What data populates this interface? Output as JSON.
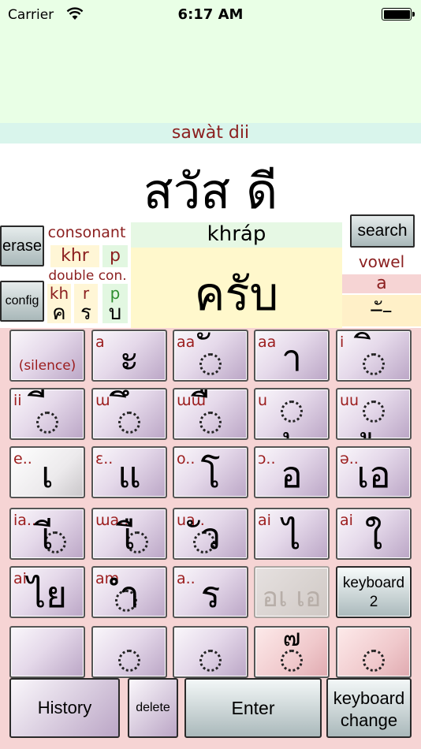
{
  "status_bar": {
    "carrier": "Carrier",
    "time": "6:17 AM"
  },
  "display": {
    "romanization": "sawàt  dii",
    "thai": "สวัส ดี"
  },
  "sidebar": {
    "erase_label": "erase",
    "config_label": "config",
    "search_label": "search"
  },
  "consonant": {
    "label": "consonant",
    "romans": [
      "khr",
      "p"
    ],
    "double_label": "double con.",
    "double": [
      {
        "roman": "kh",
        "thai": "ค"
      },
      {
        "roman": "r",
        "thai": "ร"
      },
      {
        "roman": "p",
        "thai": "บ"
      }
    ]
  },
  "current_word": {
    "roman": "khráp",
    "thai": "ครับ"
  },
  "vowel": {
    "label": "vowel",
    "roman": "a",
    "thai": "–ั–"
  },
  "keys": [
    {
      "roman": "",
      "thai": "่",
      "note": "(silence)"
    },
    {
      "roman": "a",
      "thai": "ะ"
    },
    {
      "roman": "aa",
      "thai": "ั"
    },
    {
      "roman": "aa",
      "thai": "า"
    },
    {
      "roman": "i",
      "thai": "ิ"
    },
    {
      "roman": "ii",
      "thai": "ี"
    },
    {
      "roman": "ɯ",
      "thai": "ึ"
    },
    {
      "roman": "ɯɯ",
      "thai": "ื"
    },
    {
      "roman": "u",
      "thai": "ุ"
    },
    {
      "roman": "uu",
      "thai": "ู"
    },
    {
      "roman": "e..",
      "thai": "เ"
    },
    {
      "roman": "ɛ..",
      "thai": "แ"
    },
    {
      "roman": "o..",
      "thai": "โ"
    },
    {
      "roman": "ɔ..",
      "thai": "อ"
    },
    {
      "roman": "ə..",
      "thai": "เอ"
    },
    {
      "roman": "ia..",
      "thai": "เี"
    },
    {
      "roman": "ɯa..",
      "thai": "เื"
    },
    {
      "roman": "ua..",
      "thai": "ัว"
    },
    {
      "roman": "ai",
      "thai": "ไ"
    },
    {
      "roman": "ai",
      "thai": "ใ"
    },
    {
      "roman": "ai",
      "thai": "ไย"
    },
    {
      "roman": "am",
      "thai": "ำ"
    },
    {
      "roman": "a..",
      "thai": "ร"
    },
    {
      "roman": "",
      "thai": "อเ เอ"
    },
    {
      "roman": "",
      "thai": "keyboard 2"
    },
    {
      "roman": "",
      "thai": ""
    },
    {
      "roman": "",
      "thai": "่"
    },
    {
      "roman": "",
      "thai": "้"
    },
    {
      "roman": "",
      "thai": "๗"
    },
    {
      "roman": "",
      "thai": "๋"
    }
  ],
  "bottom": {
    "history": "History",
    "delete": "delete",
    "enter": "Enter",
    "keyboard_change": "keyboard change"
  },
  "colors": {
    "roman_red": "#8b1f1f",
    "status_green": "#e9ffe6",
    "keyboard_pink": "#f6d4d4"
  }
}
